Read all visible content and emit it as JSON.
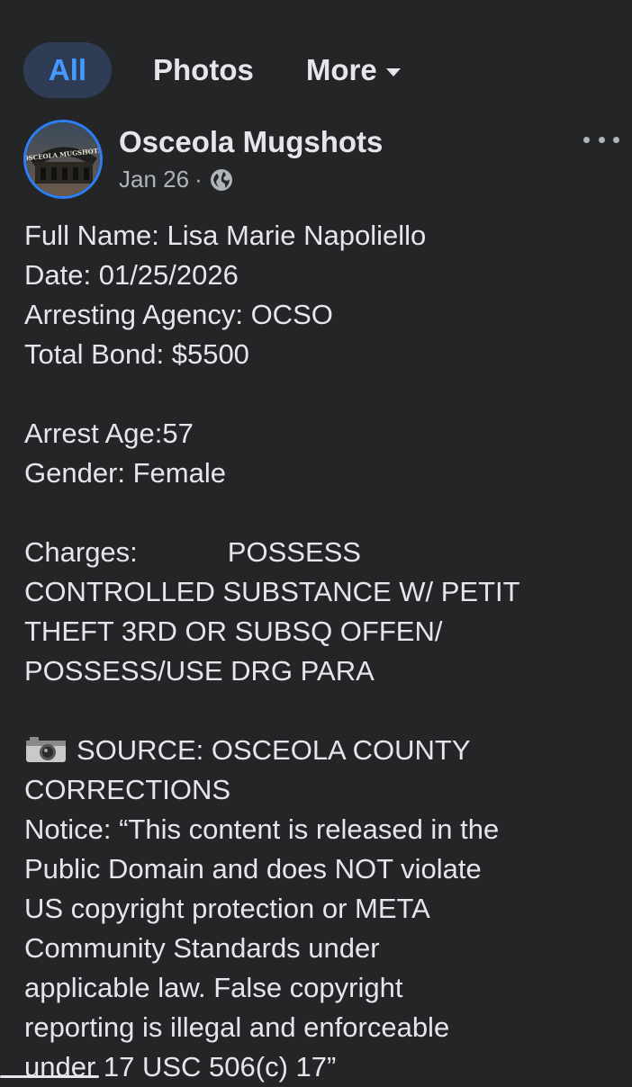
{
  "tabs": {
    "all": "All",
    "photos": "Photos",
    "more": "More"
  },
  "post": {
    "page_name": "Osceola Mugshots",
    "date": "Jan 26",
    "separator": "·",
    "privacy_icon": "globe-icon",
    "avatar_text": "OSCEOLA MUGSHOTS",
    "body": {
      "full_name": "Full Name: Lisa Marie Napoliello",
      "date": "Date: 01/25/2026",
      "agency": "Arresting Agency: OCSO",
      "bond": "Total Bond: $5500",
      "age": "Arrest Age:57",
      "gender": "Gender: Female",
      "charges_label": "Charges:",
      "charges_first": "POSSESS",
      "charges_lines": [
        "CONTROLLED SUBSTANCE W/ PETIT",
        "THEFT 3RD OR SUBSQ OFFEN/",
        "POSSESS/USE DRG PARA"
      ],
      "camera_icon": "camera-icon",
      "source_lines": [
        "SOURCE: OSCEOLA COUNTY",
        "CORRECTIONS"
      ],
      "notice_lines": [
        "Notice: “This content is released in the",
        "Public Domain and does NOT violate",
        "US copyright protection or META",
        "Community Standards under",
        "applicable law. False copyright",
        "reporting is illegal and enforceable",
        "under 17 USC 506(c) 17”"
      ]
    }
  },
  "colors": {
    "background": "#242526",
    "text": "#e4e6eb",
    "secondary": "#b0b3b8",
    "accent": "#4599ff",
    "active_tab_bg": "#2e3d55",
    "avatar_ring": "#2d7ff9"
  }
}
